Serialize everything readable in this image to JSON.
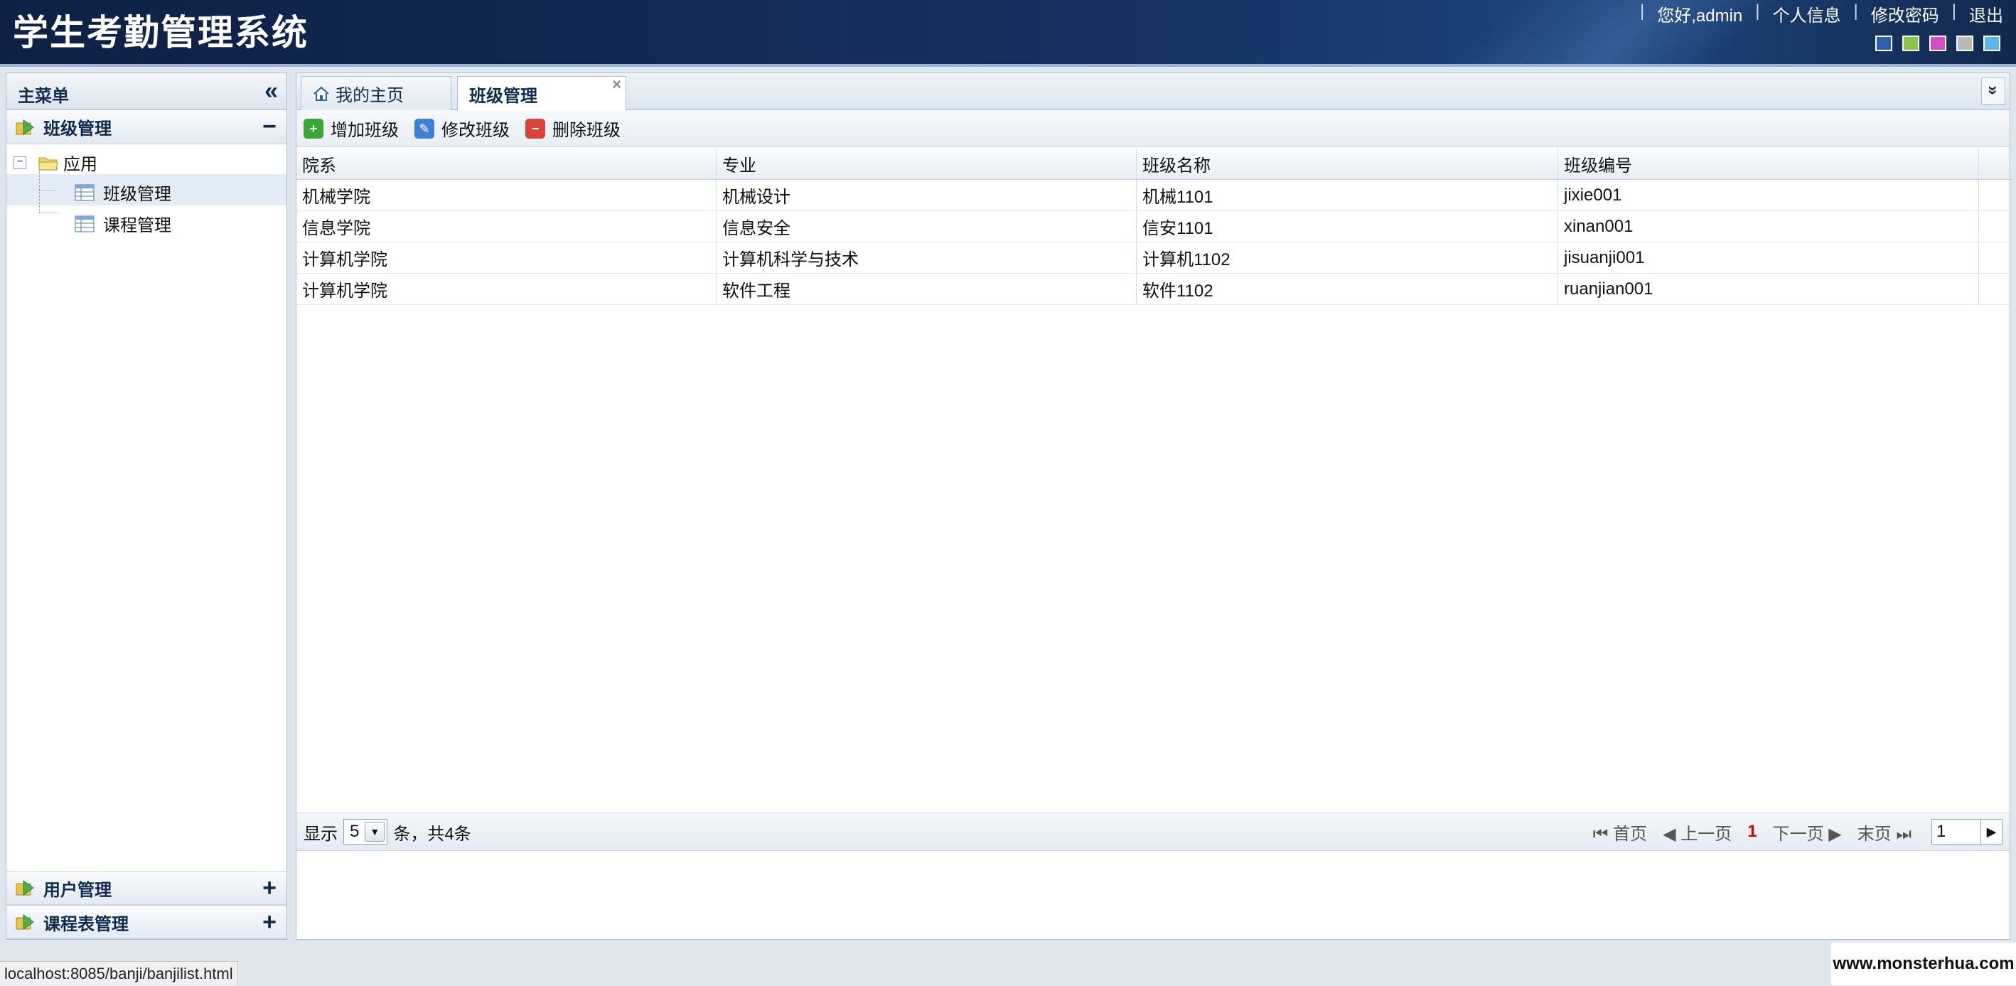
{
  "header": {
    "title": "学生考勤管理系统",
    "greeting": "您好,admin",
    "links": [
      "个人信息",
      "修改密码",
      "退出"
    ],
    "separator": "|",
    "theme_colors": [
      "#2f5fa8",
      "#8bc34a",
      "#d04fc4",
      "#b9b9b9",
      "#5db4e8"
    ]
  },
  "sidebar": {
    "title": "主菜单",
    "collapse_icon": "«",
    "sections": [
      {
        "label": "班级管理",
        "toggle": "−",
        "expanded": true
      },
      {
        "label": "用户管理",
        "toggle": "+",
        "expanded": false
      },
      {
        "label": "课程表管理",
        "toggle": "+",
        "expanded": false
      }
    ],
    "tree": {
      "root": {
        "label": "应用",
        "toggle": "−"
      },
      "items": [
        {
          "label": "班级管理",
          "selected": true
        },
        {
          "label": "课程管理",
          "selected": false
        }
      ]
    }
  },
  "tabs": [
    {
      "label": "我的主页",
      "icon": "home-icon",
      "active": false
    },
    {
      "label": "班级管理",
      "active": true,
      "close": "×"
    }
  ],
  "tab_menu_icon": "»",
  "toolbar": {
    "buttons": [
      {
        "label": "增加班级",
        "icon": "add-icon",
        "color": "#3aa834"
      },
      {
        "label": "修改班级",
        "icon": "edit-icon",
        "color": "#3b82d6"
      },
      {
        "label": "删除班级",
        "icon": "delete-icon",
        "color": "#d9433a"
      }
    ]
  },
  "table": {
    "columns": [
      "院系",
      "专业",
      "班级名称",
      "班级编号"
    ],
    "rows": [
      [
        "机械学院",
        "机械设计",
        "机械1101",
        "jixie001"
      ],
      [
        "信息学院",
        "信息安全",
        "信安1101",
        "xinan001"
      ],
      [
        "计算机学院",
        "计算机科学与技术",
        "计算机1102",
        "jisuanji001"
      ],
      [
        "计算机学院",
        "软件工程",
        "软件1102",
        "ruanjian001"
      ]
    ]
  },
  "pager": {
    "show_label": "显示",
    "page_size": "5",
    "total_label": "条，共4条",
    "first": "首页",
    "prev": "上一页",
    "current": "1",
    "next": "下一页",
    "last": "末页",
    "page_input": "1"
  },
  "statusbar": {
    "url": "localhost:8085/banji/banjilist.html"
  },
  "watermark": "www.monsterhua.com"
}
